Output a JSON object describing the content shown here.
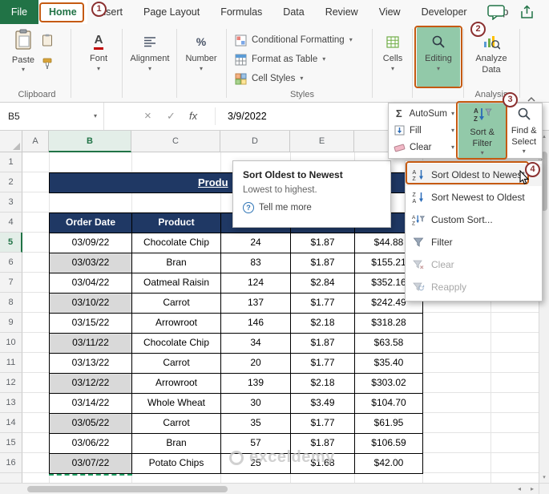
{
  "ribbon": {
    "file_tab": "File",
    "tabs": [
      "Home",
      "Insert",
      "Page Layout",
      "Formulas",
      "Data",
      "Review",
      "View",
      "Developer",
      "Help"
    ],
    "active_tab": "Home",
    "paste_label": "Paste",
    "font_label": "Font",
    "alignment_label": "Alignment",
    "number_label": "Number",
    "styles_items": [
      "Conditional Formatting",
      "Format as Table",
      "Cell Styles"
    ],
    "cells_label": "Cells",
    "editing_label": "Editing",
    "analyze_label": "Analyze Data",
    "group_labels": {
      "clipboard": "Clipboard",
      "styles": "Styles",
      "analysis": "Analysis"
    }
  },
  "formula_bar": {
    "name_box": "B5",
    "fx": "fx",
    "value": "3/9/2022"
  },
  "editing_panel": {
    "autosum": "AutoSum",
    "fill": "Fill",
    "clear": "Clear",
    "sort_filter": "Sort & Filter",
    "find_select": "Find & Select"
  },
  "sort_menu": [
    {
      "label": "Sort Oldest to Newest",
      "icon": "sort-az",
      "highlighted": true,
      "disabled": false
    },
    {
      "label": "Sort Newest to Oldest",
      "icon": "sort-za",
      "highlighted": false,
      "disabled": false
    },
    {
      "label": "Custom Sort...",
      "icon": "custom-sort",
      "highlighted": false,
      "disabled": false
    },
    {
      "label": "Filter",
      "icon": "filter",
      "highlighted": false,
      "disabled": false
    },
    {
      "label": "Clear",
      "icon": "clear-filter",
      "highlighted": false,
      "disabled": true
    },
    {
      "label": "Reapply",
      "icon": "reapply",
      "highlighted": false,
      "disabled": true
    }
  ],
  "tooltip": {
    "title": "Sort Oldest to Newest",
    "body": "Lowest to highest.",
    "link": "Tell me more"
  },
  "annotations": {
    "steps": [
      "1",
      "2",
      "3",
      "4"
    ]
  },
  "sheet": {
    "column_letters": [
      "A",
      "B",
      "C",
      "D",
      "E"
    ],
    "row_numbers": [
      "1",
      "2",
      "3",
      "4",
      "5",
      "6",
      "7",
      "8",
      "9",
      "10",
      "11",
      "12",
      "13",
      "14",
      "15",
      "16"
    ],
    "title_visible": "Produ",
    "headers": [
      "Order Date",
      "Product"
    ],
    "data": [
      [
        "03/09/22",
        "Chocolate Chip",
        "24",
        "$1.87",
        "$44.88"
      ],
      [
        "03/03/22",
        "Bran",
        "83",
        "$1.87",
        "$155.21"
      ],
      [
        "03/04/22",
        "Oatmeal Raisin",
        "124",
        "$2.84",
        "$352.16"
      ],
      [
        "03/10/22",
        "Carrot",
        "137",
        "$1.77",
        "$242.49"
      ],
      [
        "03/15/22",
        "Arrowroot",
        "146",
        "$2.18",
        "$318.28"
      ],
      [
        "03/11/22",
        "Chocolate Chip",
        "34",
        "$1.87",
        "$63.58"
      ],
      [
        "03/13/22",
        "Carrot",
        "20",
        "$1.77",
        "$35.40"
      ],
      [
        "03/12/22",
        "Arrowroot",
        "139",
        "$2.18",
        "$303.02"
      ],
      [
        "03/14/22",
        "Whole Wheat",
        "30",
        "$3.49",
        "$104.70"
      ],
      [
        "03/05/22",
        "Carrot",
        "35",
        "$1.77",
        "$61.95"
      ],
      [
        "03/06/22",
        "Bran",
        "57",
        "$1.87",
        "$106.59"
      ],
      [
        "03/07/22",
        "Potato Chips",
        "25",
        "$1.68",
        "$42.00"
      ]
    ]
  },
  "watermark": {
    "text": "exceldemy"
  },
  "colors": {
    "excel_green": "#217346",
    "table_navy": "#1F3864",
    "highlight_green": "#92C9A9",
    "annotation_orange": "#C55A11",
    "annotation_maroon": "#8B3030",
    "alt_row_gray": "#D9D9D9"
  }
}
